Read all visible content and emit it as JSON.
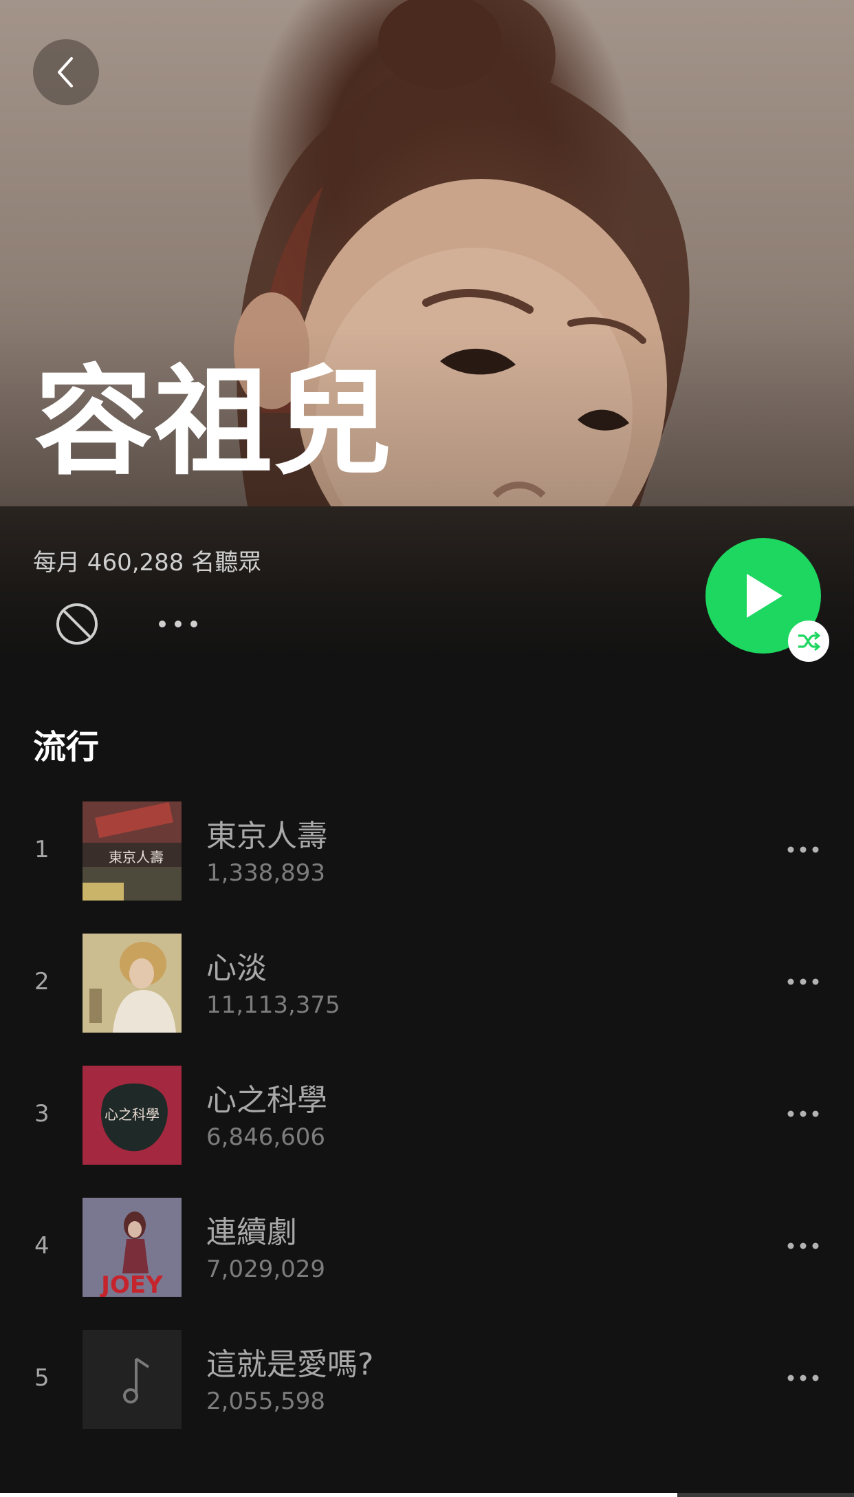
{
  "artist": {
    "name": "容祖兒",
    "monthly_listeners": "每月 460,288 名聽眾"
  },
  "section": {
    "title": "流行"
  },
  "tracks": [
    {
      "rank": "1",
      "title": "東京人壽",
      "plays": "1,338,893"
    },
    {
      "rank": "2",
      "title": "心淡",
      "plays": "11,113,375"
    },
    {
      "rank": "3",
      "title": "心之科學",
      "plays": "6,846,606"
    },
    {
      "rank": "4",
      "title": "連續劇",
      "plays": "7,029,029"
    },
    {
      "rank": "5",
      "title": "這就是愛嗎?",
      "plays": "2,055,598"
    }
  ],
  "album_art_text": {
    "track1": "東京人壽",
    "track3": "心之科學",
    "track4": "JOEY"
  },
  "colors": {
    "accent": "#1ed760",
    "background": "#121212"
  },
  "icons": {
    "back": "chevron-left-icon",
    "block": "block-icon",
    "more": "more-horizontal-icon",
    "play": "play-icon",
    "shuffle": "shuffle-icon",
    "placeholder": "music-note-icon"
  }
}
